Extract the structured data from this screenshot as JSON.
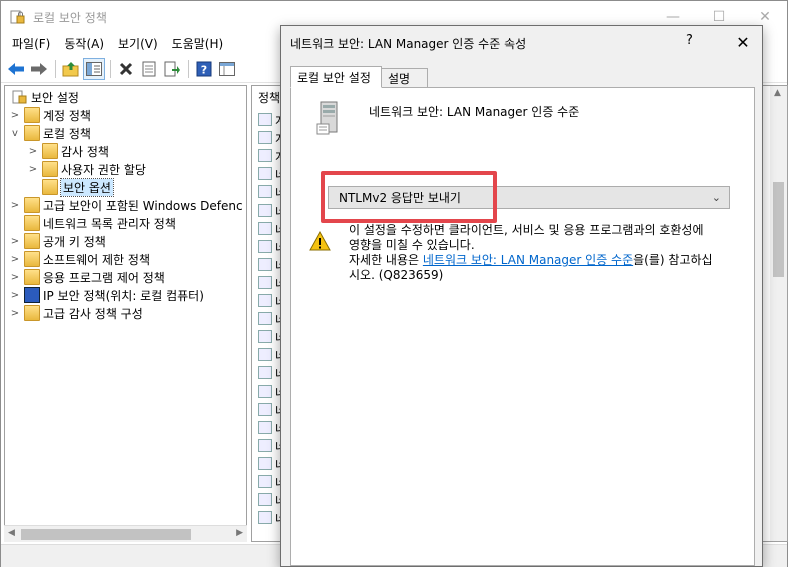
{
  "window": {
    "title": "로컬 보안 정책",
    "minimize": "—",
    "maximize": "☐",
    "close": "✕"
  },
  "menu": [
    "파일(F)",
    "동작(A)",
    "보기(V)",
    "도움말(H)"
  ],
  "toolbar": [
    "back-icon",
    "forward-icon",
    "up-folder-icon",
    "show-hide-tree-icon",
    "delete-icon",
    "properties-icon",
    "export-icon",
    "help-icon",
    "view-icon"
  ],
  "tree": {
    "root": "보안 설정",
    "items": [
      {
        "label": "계정 정책",
        "level": 1,
        "expand": ">"
      },
      {
        "label": "로컬 정책",
        "level": 1,
        "expand": "v"
      },
      {
        "label": "감사 정책",
        "level": 2,
        "expand": ">"
      },
      {
        "label": "사용자 권한 할당",
        "level": 2,
        "expand": ">"
      },
      {
        "label": "보안 옵션",
        "level": 2,
        "expand": ""
      },
      {
        "label": "고급 보안이 포함된 Windows Defenc",
        "level": 1,
        "expand": ">"
      },
      {
        "label": "네트워크 목록 관리자 정책",
        "level": 1,
        "expand": ""
      },
      {
        "label": "공개 키 정책",
        "level": 1,
        "expand": ">"
      },
      {
        "label": "소프트웨어 제한 정책",
        "level": 1,
        "expand": ">"
      },
      {
        "label": "응용 프로그램 제어 정책",
        "level": 1,
        "expand": ">"
      },
      {
        "label": "IP 보안 정책(위치: 로컬 컴퓨터)",
        "level": 1,
        "expand": ">"
      },
      {
        "label": "고급 감사 정책 구성",
        "level": 1,
        "expand": ">"
      }
    ],
    "selected_index": 4
  },
  "list": {
    "header": "정책",
    "rows": [
      "계",
      "계",
      "계",
      "네",
      "네",
      "네",
      "네",
      "네",
      "네",
      "네",
      "네",
      "네",
      "네",
      "네",
      "네",
      "네",
      "네",
      "네",
      "네",
      "네",
      "네",
      "네",
      "네"
    ]
  },
  "dialog": {
    "title": "네트워크 보안: LAN Manager 인증 수준 속성",
    "help": "?",
    "close": "✕",
    "tabs": [
      "로컬 보안 설정",
      "설명"
    ],
    "policy_name": "네트워크 보안: LAN Manager 인증 수준",
    "selected_value": "NTLMv2 응답만 보내기",
    "warning_line1": "이 설정을 수정하면 클라이언트, 서비스 및 응용 프로그램과의 호환성에",
    "warning_line2": "영향을 미칠 수 있습니다.",
    "warning_line3_prefix": "자세한 내용은 ",
    "warning_link": "네트워크 보안: LAN Manager 인증 수준",
    "warning_line3_suffix": "을(를) 참고하십",
    "warning_line4": "시오. (Q823659)"
  },
  "colors": {
    "highlight_border": "#e3464c",
    "link": "#0066cc",
    "selection": "#cce8ff"
  }
}
